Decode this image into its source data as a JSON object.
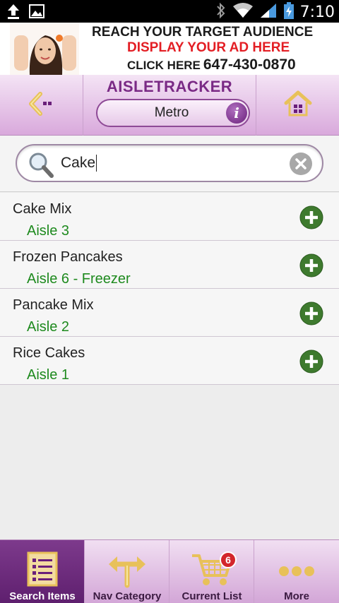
{
  "status_bar": {
    "time": "7:10",
    "icons": [
      "upload-icon",
      "image-icon",
      "bluetooth-icon",
      "wifi-icon",
      "signal-icon",
      "battery-charging-icon"
    ]
  },
  "ad": {
    "line1": "REACH YOUR TARGET AUDIENCE",
    "line2": "DISPLAY YOUR AD HERE",
    "line3_prefix": "CLICK HERE",
    "line3_phone": "647-430-0870"
  },
  "header": {
    "title": "AISLETRACKER",
    "store": "Metro",
    "info_glyph": "i"
  },
  "search": {
    "value": "Cake",
    "placeholder": ""
  },
  "results": [
    {
      "name": "Cake Mix",
      "aisle": "Aisle 3"
    },
    {
      "name": "Frozen Pancakes",
      "aisle": "Aisle 6 - Freezer"
    },
    {
      "name": "Pancake Mix",
      "aisle": "Aisle 2"
    },
    {
      "name": "Rice Cakes",
      "aisle": "Aisle 1"
    }
  ],
  "bottom_nav": {
    "tabs": [
      {
        "label": "Search Items",
        "icon": "list-icon",
        "active": true
      },
      {
        "label": "Nav Category",
        "icon": "directions-icon",
        "active": false
      },
      {
        "label": "Current List",
        "icon": "cart-icon",
        "active": false,
        "badge": "6"
      },
      {
        "label": "More",
        "icon": "more-dots-icon",
        "active": false
      }
    ]
  },
  "colors": {
    "accent_purple": "#7a2a85",
    "aisle_green": "#1e8a1e",
    "add_button_green": "#3e7a2e",
    "ad_red": "#e31e24",
    "badge_red": "#d3262c"
  }
}
